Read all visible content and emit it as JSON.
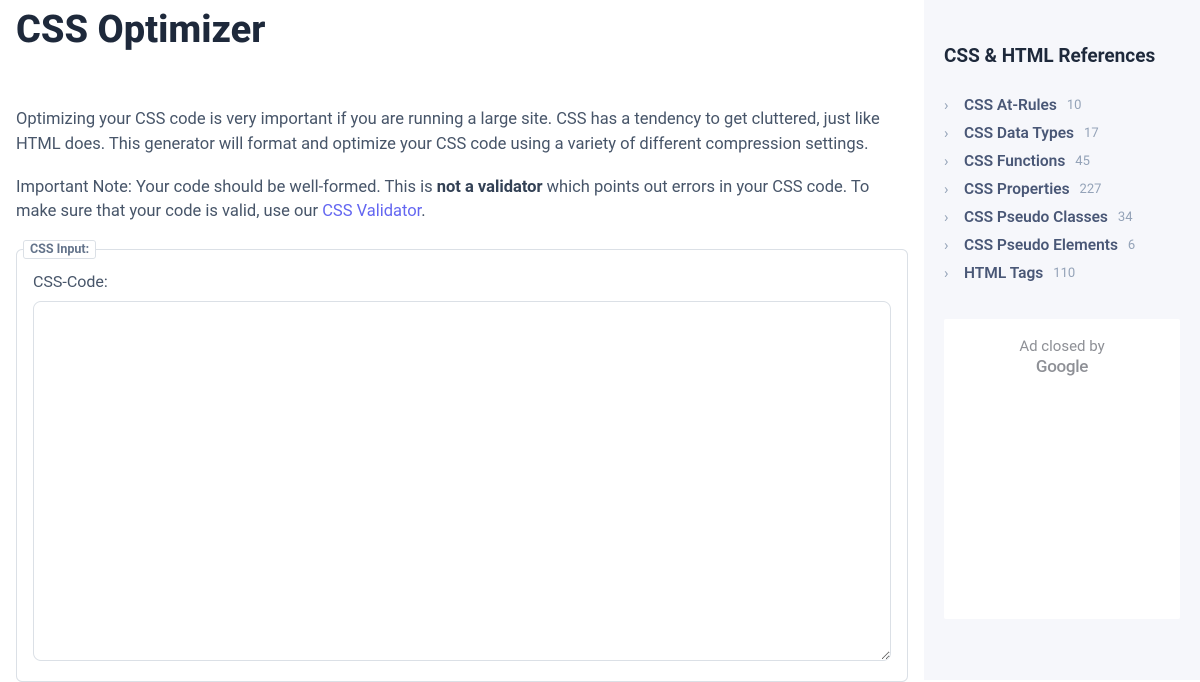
{
  "main": {
    "title": "CSS Optimizer",
    "intro1": "Optimizing your CSS code is very important if you are running a large site. CSS has a tendency to get cluttered, just like HTML does. This generator will format and optimize your CSS code using a variety of different compression settings.",
    "note_prefix": "Important Note: Your code should be well-formed. This is ",
    "note_bold": "not a validator",
    "note_mid": " which points out errors in your CSS code. To make sure that your code is valid, use our ",
    "note_link": "CSS Validator",
    "note_suffix": ".",
    "fieldset_legend": "CSS Input:",
    "code_label": "CSS-Code:",
    "textarea_value": ""
  },
  "sidebar": {
    "title": "CSS & HTML References",
    "items": [
      {
        "label": "CSS At-Rules",
        "count": "10"
      },
      {
        "label": "CSS Data Types",
        "count": "17"
      },
      {
        "label": "CSS Functions",
        "count": "45"
      },
      {
        "label": "CSS Properties",
        "count": "227"
      },
      {
        "label": "CSS Pseudo Classes",
        "count": "34"
      },
      {
        "label": "CSS Pseudo Elements",
        "count": "6"
      },
      {
        "label": "HTML Tags",
        "count": "110"
      }
    ],
    "ad_line1": "Ad closed by",
    "ad_line2": "Google"
  }
}
